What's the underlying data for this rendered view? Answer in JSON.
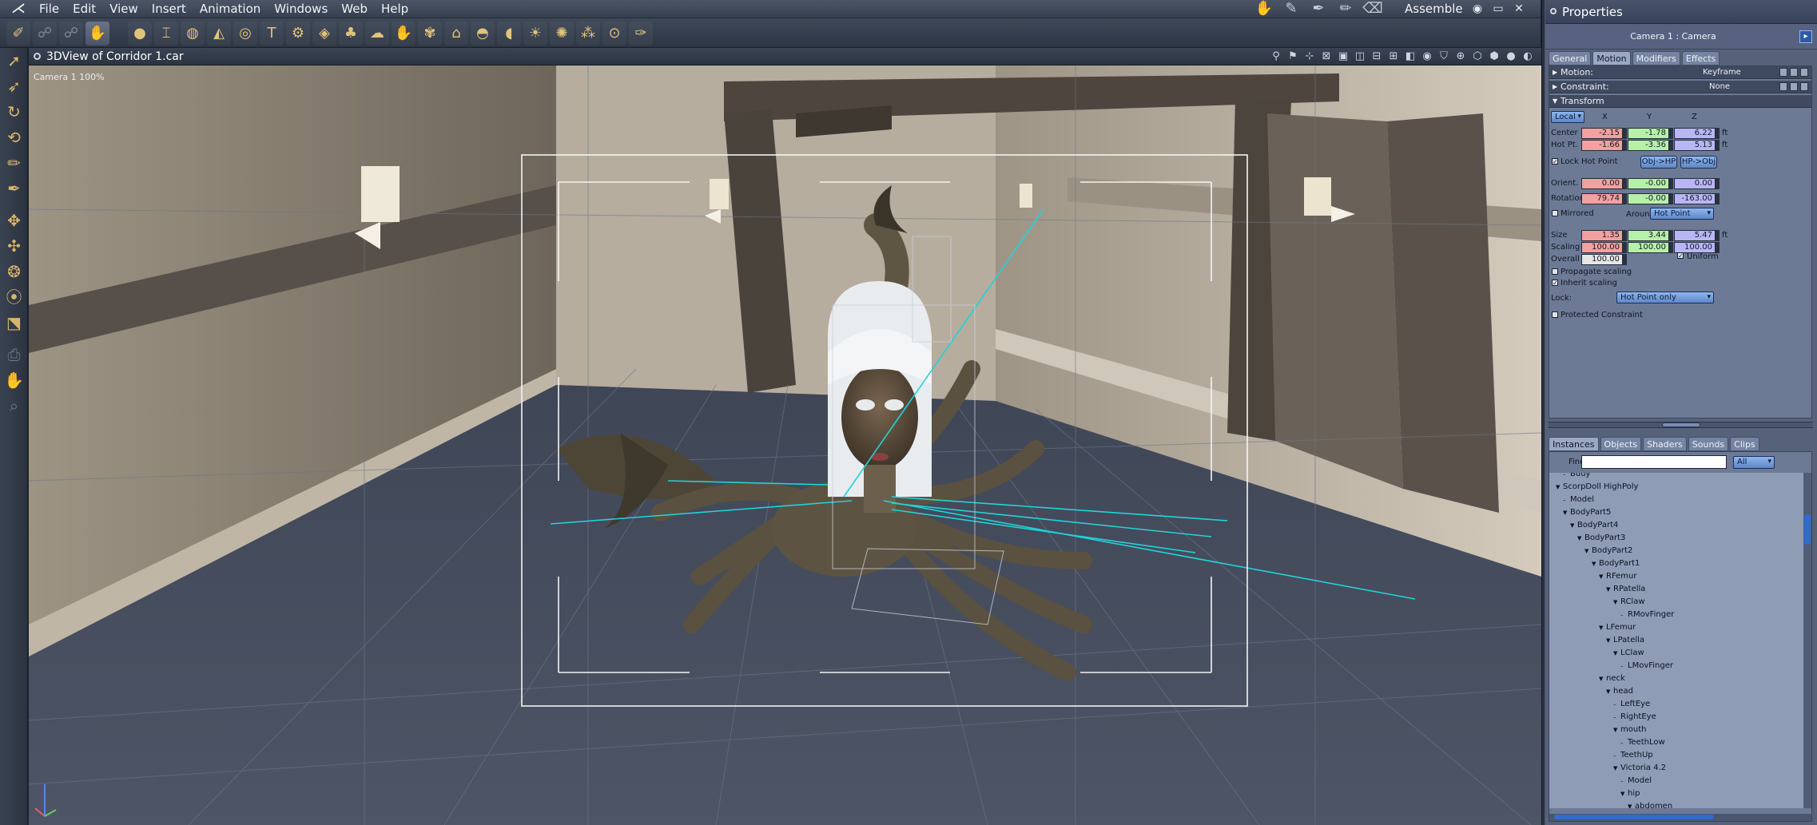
{
  "app": {
    "menu": [
      "File",
      "Edit",
      "View",
      "Insert",
      "Animation",
      "Windows",
      "Web",
      "Help"
    ],
    "room": "Assemble",
    "window_controls": [
      "◉",
      "▭",
      "✕"
    ]
  },
  "viewport": {
    "title": "3DView of Corridor 1.car",
    "camera_label": "Camera 1 100%"
  },
  "properties": {
    "title": "Properties",
    "subject": "Camera 1 : Camera",
    "tabs": [
      "General",
      "Motion",
      "Modifiers",
      "Effects"
    ],
    "active_tab": "Motion",
    "motion": {
      "label": "Motion:",
      "value": "Keyframe"
    },
    "constraint": {
      "label": "Constraint:",
      "value": "None"
    },
    "transform": {
      "label": "Transform",
      "space": "Local",
      "headers": [
        "X",
        "Y",
        "Z"
      ],
      "center": {
        "label": "Center",
        "x": "-2.15",
        "y": "-1.78",
        "z": "6.22",
        "unit": "ft"
      },
      "hotpt": {
        "label": "Hot Pt.",
        "x": "-1.66",
        "y": "-3.36",
        "z": "5.13",
        "unit": "ft"
      },
      "lock_hot_point": "Lock Hot Point",
      "obj_hp": "Obj->HP",
      "hp_obj": "HP->Obj",
      "orient": {
        "label": "Orient.",
        "x": "0.00",
        "y": "-0.00",
        "z": "0.00"
      },
      "rotation": {
        "label": "Rotation",
        "x": "79.74",
        "y": "-0.00",
        "z": "-163.00"
      },
      "mirrored": "Mirrored",
      "around_label": "Around",
      "around_value": "Hot Point",
      "size": {
        "label": "Size",
        "x": "1.35",
        "y": "3.44",
        "z": "5.47",
        "unit": "ft"
      },
      "scaling": {
        "label": "Scaling",
        "x": "100.00",
        "y": "100.00",
        "z": "100.00"
      },
      "overall": {
        "label": "Overall",
        "value": "100.00"
      },
      "uniform": "Uniform",
      "propagate": "Propagate scaling",
      "inherit": "Inherit scaling",
      "lock_label": "Lock:",
      "lock_value": "Hot Point only",
      "protected": "Protected Constraint"
    }
  },
  "browser": {
    "tabs": [
      "Instances",
      "Objects",
      "Shaders",
      "Sounds",
      "Clips"
    ],
    "active_tab": "Instances",
    "find_label": "Find:",
    "find_value": "",
    "filter": "All",
    "tree": [
      {
        "label": "Buuy",
        "depth": 1,
        "expander": false
      },
      {
        "label": "ScorpDoll HighPoly",
        "depth": 0,
        "expander": true
      },
      {
        "label": "Model",
        "depth": 1,
        "expander": false
      },
      {
        "label": "BodyPart5",
        "depth": 1,
        "expander": true
      },
      {
        "label": "BodyPart4",
        "depth": 2,
        "expander": true
      },
      {
        "label": "BodyPart3",
        "depth": 3,
        "expander": true
      },
      {
        "label": "BodyPart2",
        "depth": 4,
        "expander": true
      },
      {
        "label": "BodyPart1",
        "depth": 5,
        "expander": true
      },
      {
        "label": "RFemur",
        "depth": 6,
        "expander": true
      },
      {
        "label": "RPatella",
        "depth": 7,
        "expander": true
      },
      {
        "label": "RClaw",
        "depth": 8,
        "expander": true
      },
      {
        "label": "RMovFinger",
        "depth": 9,
        "expander": false
      },
      {
        "label": "LFemur",
        "depth": 6,
        "expander": true
      },
      {
        "label": "LPatella",
        "depth": 7,
        "expander": true
      },
      {
        "label": "LClaw",
        "depth": 8,
        "expander": true
      },
      {
        "label": "LMovFinger",
        "depth": 9,
        "expander": false
      },
      {
        "label": "neck",
        "depth": 6,
        "expander": true
      },
      {
        "label": "head",
        "depth": 7,
        "expander": true
      },
      {
        "label": "LeftEye",
        "depth": 8,
        "expander": false
      },
      {
        "label": "RightEye",
        "depth": 8,
        "expander": false
      },
      {
        "label": "mouth",
        "depth": 8,
        "expander": true
      },
      {
        "label": "TeethLow",
        "depth": 9,
        "expander": false
      },
      {
        "label": "TeethUp",
        "depth": 8,
        "expander": false
      },
      {
        "label": "Victoria 4.2",
        "depth": 8,
        "expander": true
      },
      {
        "label": "Model",
        "depth": 9,
        "expander": false
      },
      {
        "label": "hip",
        "depth": 9,
        "expander": true
      },
      {
        "label": "abdomen",
        "depth": 10,
        "expander": true
      }
    ]
  },
  "icons": {
    "toolbar": [
      "select-tool-icon",
      "bones-tool-icon",
      "ik-tool-icon",
      "hand-tool-icon",
      "sphere-primitive-icon",
      "cylinder-primitive-icon",
      "torus-primitive-icon",
      "cone-primitive-icon",
      "terrain-icon",
      "text-icon",
      "gear-icon",
      "plane-icon",
      "tree-icon",
      "cloud-icon",
      "hand-icon",
      "figure-icon",
      "house-icon",
      "rock-icon",
      "egg-icon",
      "light-icon",
      "bug-icon",
      "crawler-icon",
      "target-icon",
      "wrench-icon"
    ]
  }
}
